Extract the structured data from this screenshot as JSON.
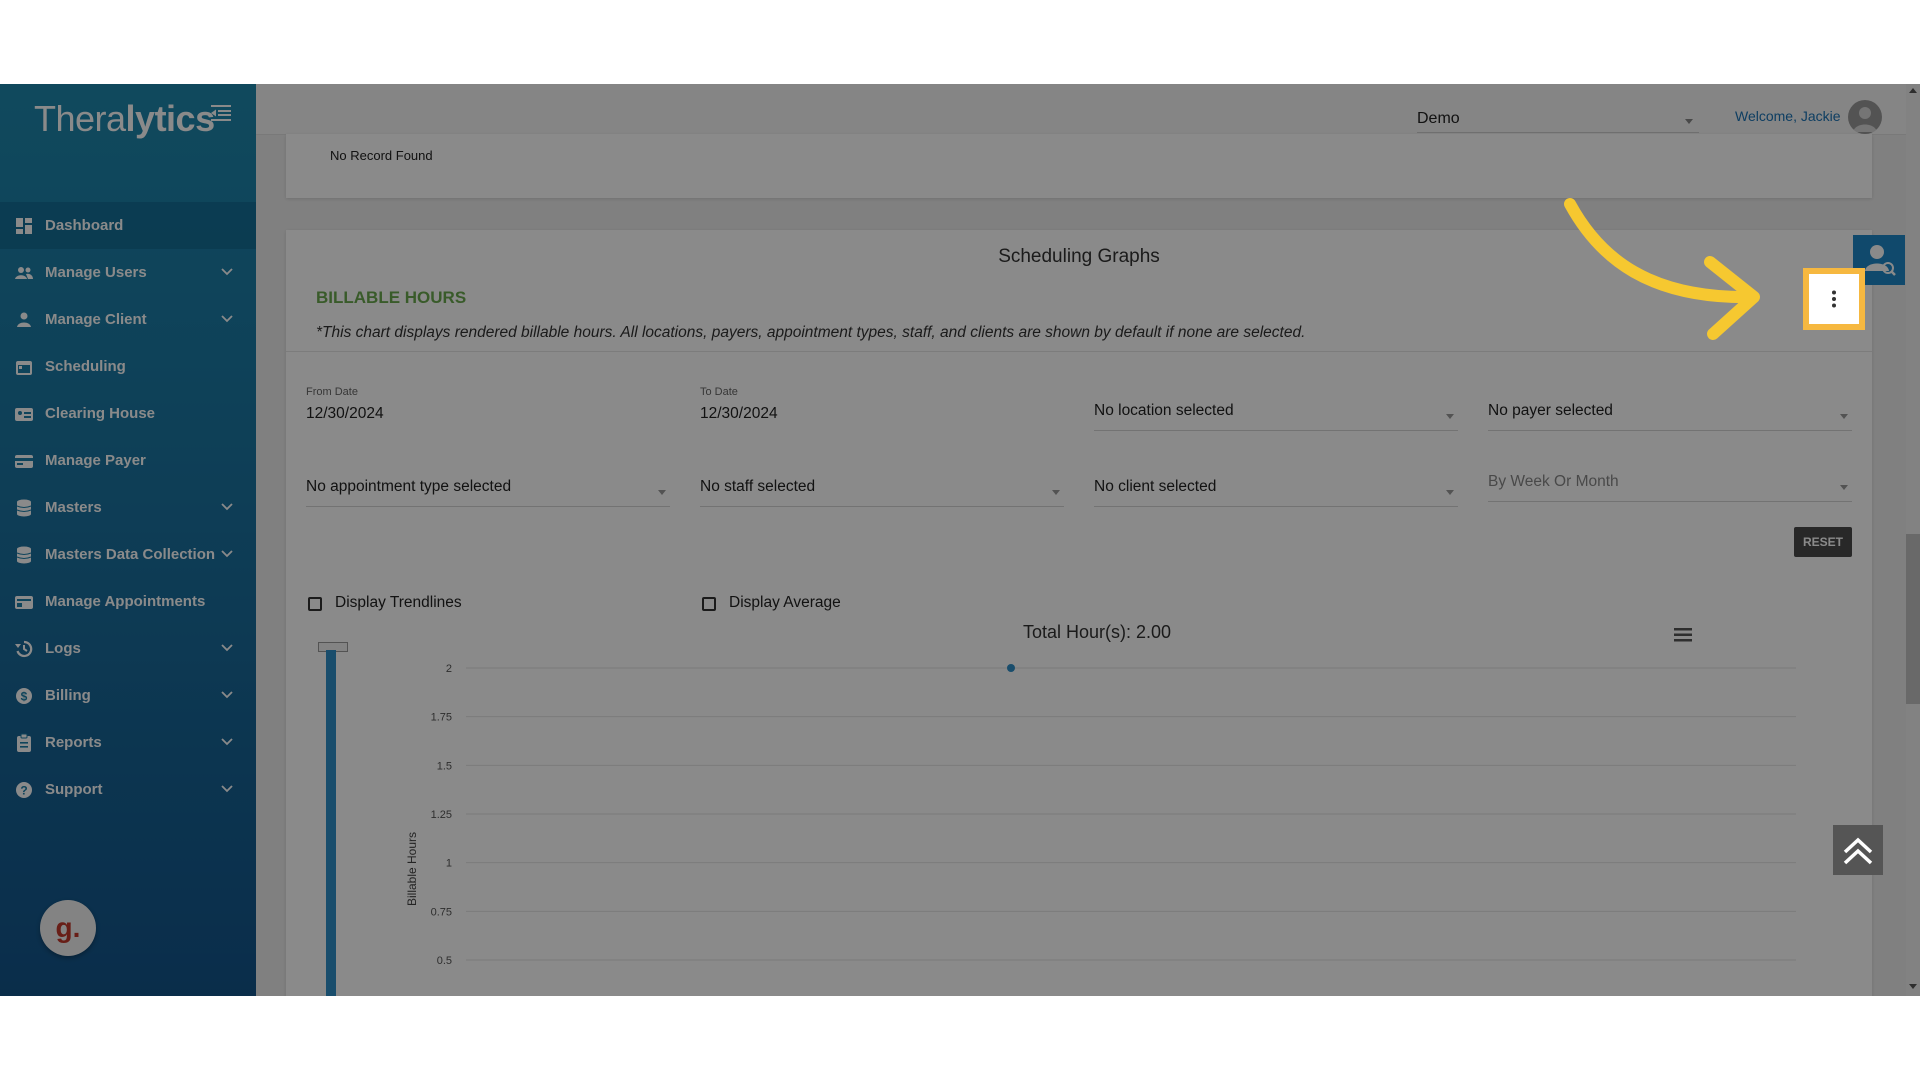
{
  "brand": {
    "logo_prefix": "Thera",
    "logo_suffix": "lytics"
  },
  "sidebar": {
    "items": [
      {
        "label": "Dashboard",
        "icon": "dashboard-icon",
        "expandable": false
      },
      {
        "label": "Manage Users",
        "icon": "users-icon",
        "expandable": true
      },
      {
        "label": "Manage Client",
        "icon": "person-icon",
        "expandable": true
      },
      {
        "label": "Scheduling",
        "icon": "calendar-icon",
        "expandable": false
      },
      {
        "label": "Clearing House",
        "icon": "id-card-icon",
        "expandable": false
      },
      {
        "label": "Manage Payer",
        "icon": "payer-card-icon",
        "expandable": false
      },
      {
        "label": "Masters",
        "icon": "database-icon",
        "expandable": true
      },
      {
        "label": "Masters Data Collection",
        "icon": "database-icon",
        "expandable": true
      },
      {
        "label": "Manage Appointments",
        "icon": "appointment-card-icon",
        "expandable": false
      },
      {
        "label": "Logs",
        "icon": "history-icon",
        "expandable": true
      },
      {
        "label": "Billing",
        "icon": "dollar-icon",
        "expandable": true
      },
      {
        "label": "Reports",
        "icon": "clipboard-icon",
        "expandable": true
      },
      {
        "label": "Support",
        "icon": "help-icon",
        "expandable": true
      }
    ],
    "widget_letter": "g."
  },
  "topbar": {
    "org_select": "Demo",
    "welcome": "Welcome, Jackie"
  },
  "records": {
    "empty_text": "No Record Found"
  },
  "graphs": {
    "section_title": "Scheduling Graphs",
    "chart_heading": "BILLABLE HOURS",
    "note": "*This chart displays rendered billable hours. All locations, payers, appointment types, staff, and clients are shown by default if none are selected.",
    "filters": {
      "from_label": "From Date",
      "from_value": "12/30/2024",
      "to_label": "To Date",
      "to_value": "12/30/2024",
      "location": "No location selected",
      "payer": "No payer selected",
      "appointment_type": "No appointment type selected",
      "staff": "No staff selected",
      "client": "No client selected",
      "period_placeholder": "By Week Or Month"
    },
    "reset_label": "RESET",
    "display_trendlines": "Display Trendlines",
    "display_average": "Display Average"
  },
  "chart_data": {
    "type": "line",
    "title": "Total Hour(s): 2.00",
    "ylabel": "Billable Hours",
    "xlabel": "",
    "ylim": [
      0.5,
      2
    ],
    "yticks": [
      "2",
      "1.75",
      "1.5",
      "1.25",
      "1",
      "0.75",
      "0.5"
    ],
    "series": [
      {
        "values": [
          2
        ]
      }
    ],
    "point_color": "#2f8ec7",
    "grid": true
  },
  "colors": {
    "accent": "#1e88c8",
    "highlight": "#f6b840",
    "arrow": "#f6c830",
    "heading_green": "#6aa84f"
  }
}
